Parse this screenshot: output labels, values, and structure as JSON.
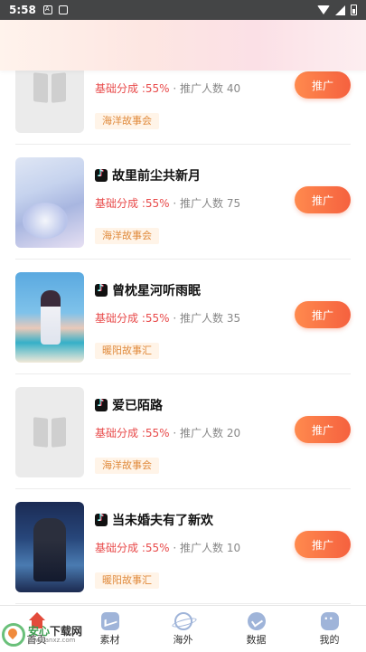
{
  "status_bar": {
    "time": "5:58"
  },
  "items": [
    {
      "title": "",
      "ratio_label": "基础分成 :55%",
      "sep": "·",
      "count_label": "推广人数 40",
      "tag": "海洋故事会",
      "button": "推广"
    },
    {
      "title": "故里前尘共新月",
      "ratio_label": "基础分成 :55%",
      "sep": "·",
      "count_label": "推广人数 75",
      "tag": "海洋故事会",
      "button": "推广"
    },
    {
      "title": "曾枕星河听雨眠",
      "ratio_label": "基础分成 :55%",
      "sep": "·",
      "count_label": "推广人数 35",
      "tag": "暖阳故事汇",
      "button": "推广"
    },
    {
      "title": "爱已陌路",
      "ratio_label": "基础分成 :55%",
      "sep": "·",
      "count_label": "推广人数 20",
      "tag": "海洋故事会",
      "button": "推广"
    },
    {
      "title": "当未婚夫有了新欢",
      "ratio_label": "基础分成 :55%",
      "sep": "·",
      "count_label": "推广人数 10",
      "tag": "暖阳故事汇",
      "button": "推广"
    }
  ],
  "tabbar": {
    "tabs": [
      {
        "label": "首页",
        "icon": "home-icon"
      },
      {
        "label": "素材",
        "icon": "material-icon"
      },
      {
        "label": "海外",
        "icon": "globe-icon"
      },
      {
        "label": "数据",
        "icon": "data-icon"
      },
      {
        "label": "我的",
        "icon": "profile-icon"
      }
    ]
  },
  "watermark": {
    "main_a": "安心",
    "main_b": "下载网",
    "url": "www.anxz.com"
  }
}
